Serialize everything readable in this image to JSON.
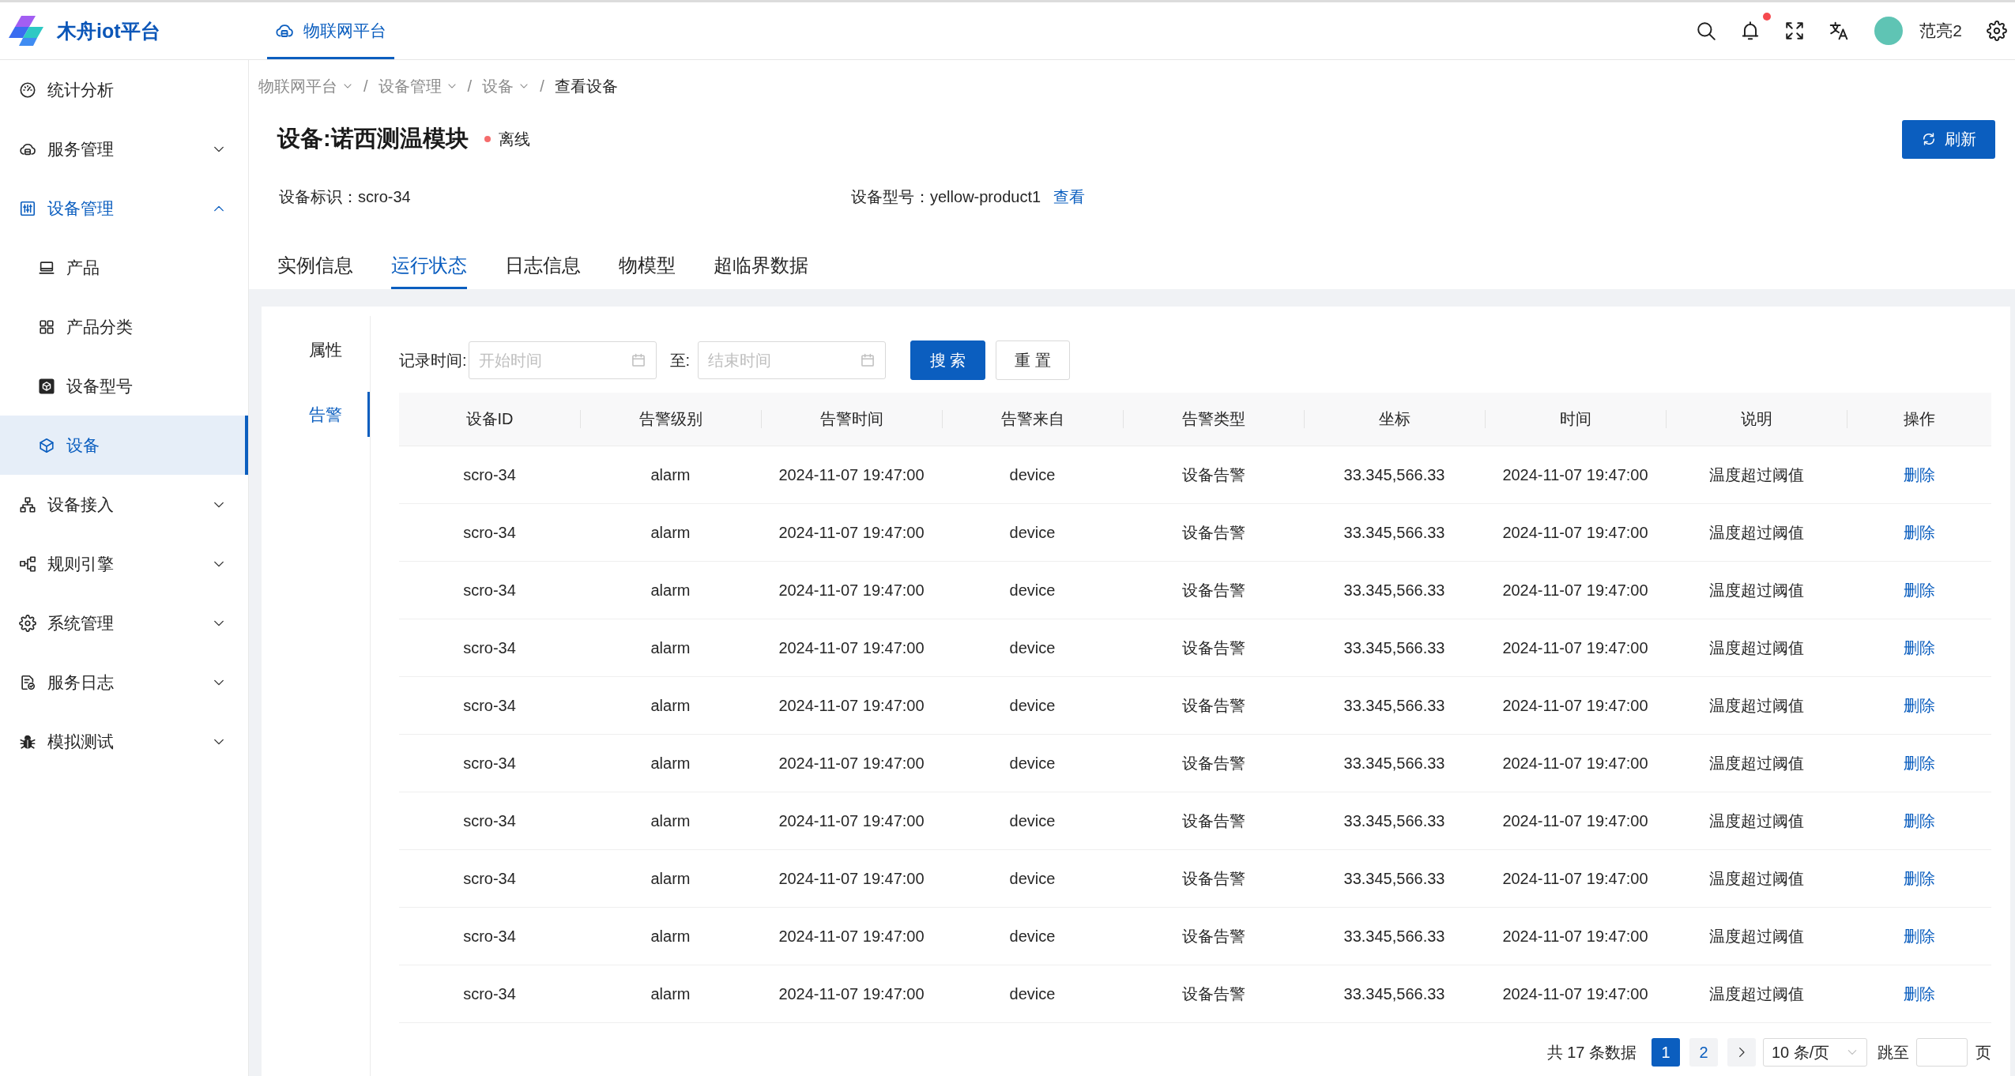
{
  "app": {
    "name": "木舟iot平台"
  },
  "top_nav": [
    {
      "label": "物联网平台",
      "selected": true
    }
  ],
  "header": {
    "has_notifications": true,
    "user_name": "范亮2"
  },
  "sidebar": {
    "items": [
      {
        "kind": "link",
        "label": "统计分析",
        "selected": false
      },
      {
        "kind": "group",
        "label": "服务管理",
        "selected": false,
        "expanded": false
      },
      {
        "kind": "group",
        "label": "设备管理",
        "selected": false,
        "expanded": true,
        "children": [
          {
            "label": "产品",
            "selected": false
          },
          {
            "label": "产品分类",
            "selected": false
          },
          {
            "label": "设备型号",
            "selected": false
          },
          {
            "label": "设备",
            "selected": true
          }
        ]
      },
      {
        "kind": "group",
        "label": "设备接入",
        "selected": false,
        "expanded": false
      },
      {
        "kind": "group",
        "label": "规则引擎",
        "selected": false,
        "expanded": false
      },
      {
        "kind": "group",
        "label": "系统管理",
        "selected": false,
        "expanded": false
      },
      {
        "kind": "group",
        "label": "服务日志",
        "selected": false,
        "expanded": false
      },
      {
        "kind": "group",
        "label": "模拟测试",
        "selected": false,
        "expanded": false
      }
    ]
  },
  "breadcrumb": {
    "separator": "/",
    "items": [
      {
        "kind": "menu",
        "label": "物联网平台"
      },
      {
        "kind": "menu",
        "label": "设备管理"
      },
      {
        "kind": "menu",
        "label": "设备"
      },
      {
        "kind": "current",
        "label": "查看设备"
      }
    ]
  },
  "device": {
    "title": "设备:诺西测温模块",
    "online": false,
    "status": "离线",
    "fields": [
      {
        "label": "设备标识：",
        "value": "scro-34"
      },
      {
        "label": "设备型号：",
        "value": "yellow-product1",
        "link": "查看"
      }
    ]
  },
  "refresh_button": {
    "label": "刷新"
  },
  "tabs": [
    {
      "label": "实例信息",
      "selected": false
    },
    {
      "label": "运行状态",
      "selected": true
    },
    {
      "label": "日志信息",
      "selected": false
    },
    {
      "label": "物模型",
      "selected": false
    },
    {
      "label": "超临界数据",
      "selected": false
    }
  ],
  "side_tabs": [
    {
      "label": "属性",
      "selected": false
    },
    {
      "label": "告警",
      "selected": true
    }
  ],
  "filter": {
    "label": "记录时间:",
    "start": {
      "placeholder": "开始时间"
    },
    "separator": "至:",
    "end": {
      "placeholder": "结束时间"
    },
    "buttons": [
      {
        "kind": "primary",
        "label": "搜 索"
      },
      {
        "kind": "default",
        "label": "重 置"
      }
    ]
  },
  "table": {
    "columns": [
      "设备ID",
      "告警级别",
      "告警时间",
      "告警来自",
      "告警类型",
      "坐标",
      "时间",
      "说明",
      "操作"
    ],
    "rows": [
      {
        "cells": [
          "scro-34",
          "alarm",
          "2024-11-07 19:47:00",
          "device",
          "设备告警",
          "33.345,566.33",
          "2024-11-07 19:47:00",
          "温度超过阈值"
        ],
        "action": "删除"
      },
      {
        "cells": [
          "scro-34",
          "alarm",
          "2024-11-07 19:47:00",
          "device",
          "设备告警",
          "33.345,566.33",
          "2024-11-07 19:47:00",
          "温度超过阈值"
        ],
        "action": "删除"
      },
      {
        "cells": [
          "scro-34",
          "alarm",
          "2024-11-07 19:47:00",
          "device",
          "设备告警",
          "33.345,566.33",
          "2024-11-07 19:47:00",
          "温度超过阈值"
        ],
        "action": "删除"
      },
      {
        "cells": [
          "scro-34",
          "alarm",
          "2024-11-07 19:47:00",
          "device",
          "设备告警",
          "33.345,566.33",
          "2024-11-07 19:47:00",
          "温度超过阈值"
        ],
        "action": "删除"
      },
      {
        "cells": [
          "scro-34",
          "alarm",
          "2024-11-07 19:47:00",
          "device",
          "设备告警",
          "33.345,566.33",
          "2024-11-07 19:47:00",
          "温度超过阈值"
        ],
        "action": "删除"
      },
      {
        "cells": [
          "scro-34",
          "alarm",
          "2024-11-07 19:47:00",
          "device",
          "设备告警",
          "33.345,566.33",
          "2024-11-07 19:47:00",
          "温度超过阈值"
        ],
        "action": "删除"
      },
      {
        "cells": [
          "scro-34",
          "alarm",
          "2024-11-07 19:47:00",
          "device",
          "设备告警",
          "33.345,566.33",
          "2024-11-07 19:47:00",
          "温度超过阈值"
        ],
        "action": "删除"
      },
      {
        "cells": [
          "scro-34",
          "alarm",
          "2024-11-07 19:47:00",
          "device",
          "设备告警",
          "33.345,566.33",
          "2024-11-07 19:47:00",
          "温度超过阈值"
        ],
        "action": "删除"
      },
      {
        "cells": [
          "scro-34",
          "alarm",
          "2024-11-07 19:47:00",
          "device",
          "设备告警",
          "33.345,566.33",
          "2024-11-07 19:47:00",
          "温度超过阈值"
        ],
        "action": "删除"
      },
      {
        "cells": [
          "scro-34",
          "alarm",
          "2024-11-07 19:47:00",
          "device",
          "设备告警",
          "33.345,566.33",
          "2024-11-07 19:47:00",
          "温度超过阈值"
        ],
        "action": "删除"
      }
    ]
  },
  "pagination": {
    "total": "共 17 条数据",
    "pages": [
      {
        "label": "1",
        "selected": true
      },
      {
        "label": "2",
        "selected": false
      }
    ],
    "page_size": "10 条/页",
    "jump_label": "跳至",
    "jump_suffix": "页"
  }
}
